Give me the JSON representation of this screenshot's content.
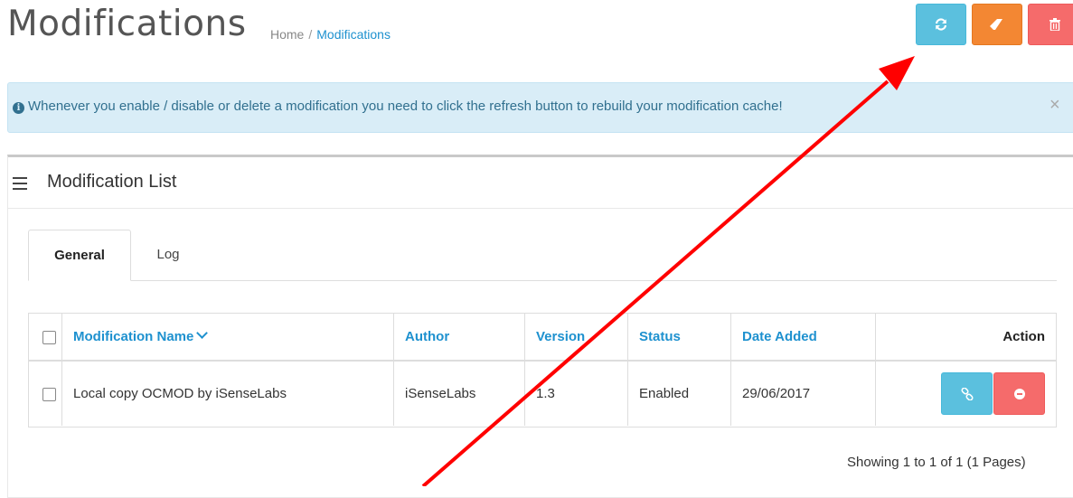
{
  "header": {
    "title": "Modifications",
    "breadcrumb": [
      {
        "label": "Home"
      },
      {
        "label": "Modifications"
      }
    ],
    "breadcrumb_separator": "/",
    "buttons": [
      {
        "name": "refresh",
        "icon": "refresh-icon",
        "color": "#5bc0de"
      },
      {
        "name": "clear",
        "icon": "eraser-icon",
        "color": "#f38733"
      },
      {
        "name": "delete",
        "icon": "trash-icon",
        "color": "#f56b6b"
      }
    ]
  },
  "alert": {
    "icon": "info-circle-icon",
    "message": "Whenever you enable / disable or delete a modification you need to click the refresh button to rebuild your modification cache!",
    "close_label": "×"
  },
  "panel": {
    "icon": "list-icon",
    "title": "Modification List",
    "tabs": [
      {
        "label": "General",
        "active": true
      },
      {
        "label": "Log",
        "active": false
      }
    ],
    "table": {
      "columns": [
        "Modification Name",
        "Author",
        "Version",
        "Status",
        "Date Added",
        "Action"
      ],
      "sort_column": "Modification Name",
      "rows": [
        {
          "checked": false,
          "name": "Local copy OCMOD by iSenseLabs",
          "author": "iSenseLabs",
          "version": "1.3",
          "status": "Enabled",
          "date_added": "29/06/2017",
          "actions": [
            {
              "name": "link",
              "icon": "link-icon",
              "color": "#5bc0de"
            },
            {
              "name": "disable",
              "icon": "minus-circle-icon",
              "color": "#f56b6b"
            }
          ]
        }
      ]
    },
    "pagination": "Showing 1 to 1 of 1 (1 Pages)"
  },
  "annotation": {
    "icon": "red-arrow",
    "color": "#ff0000"
  }
}
